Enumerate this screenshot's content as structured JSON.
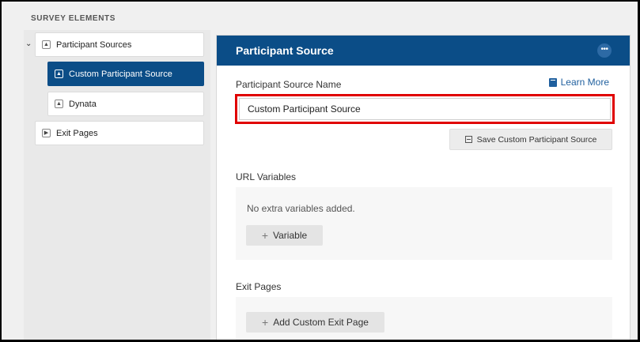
{
  "sidebar": {
    "title": "SURVEY ELEMENTS",
    "items": [
      {
        "label": "Participant Sources",
        "icon": "participant-icon"
      },
      {
        "label": "Custom Participant Source",
        "icon": "participant-icon",
        "active": true
      },
      {
        "label": "Dynata",
        "icon": "participant-icon"
      },
      {
        "label": "Exit Pages",
        "icon": "exit-icon"
      }
    ]
  },
  "card": {
    "title": "Participant Source",
    "more_label": "•••",
    "name_label": "Participant Source Name",
    "learn_more": "Learn More",
    "name_value": "Custom Participant Source",
    "save_label": "Save Custom Participant Source",
    "url_variables": {
      "heading": "URL Variables",
      "empty": "No extra variables added.",
      "button": "Variable"
    },
    "exit_pages": {
      "heading": "Exit Pages",
      "button": "Add Custom Exit Page"
    }
  },
  "colors": {
    "primary": "#0b4d87",
    "highlight": "#e00000",
    "link": "#1f5f9e"
  }
}
